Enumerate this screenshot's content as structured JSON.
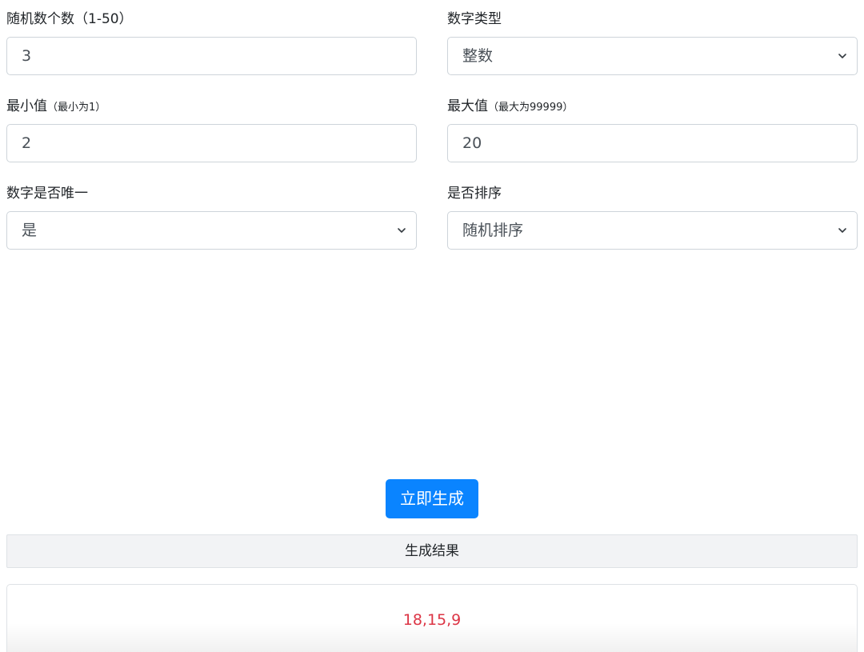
{
  "form": {
    "count": {
      "label": "随机数个数（1-50）",
      "value": "3"
    },
    "type": {
      "label": "数字类型",
      "value": "整数"
    },
    "min": {
      "label": "最小值",
      "hint": "（最小为1）",
      "value": "2"
    },
    "max": {
      "label": "最大值",
      "hint": "（最大为99999）",
      "value": "20"
    },
    "unique": {
      "label": "数字是否唯一",
      "value": "是"
    },
    "sort": {
      "label": "是否排序",
      "value": "随机排序"
    }
  },
  "actions": {
    "generate_label": "立即生成"
  },
  "result": {
    "header": "生成结果",
    "value": "18,15,9"
  },
  "colors": {
    "primary": "#0a84ff",
    "result_text": "#dc3545",
    "header_bg": "#f2f3f5"
  },
  "icons": {
    "select_arrow": "chevron-down-icon"
  }
}
